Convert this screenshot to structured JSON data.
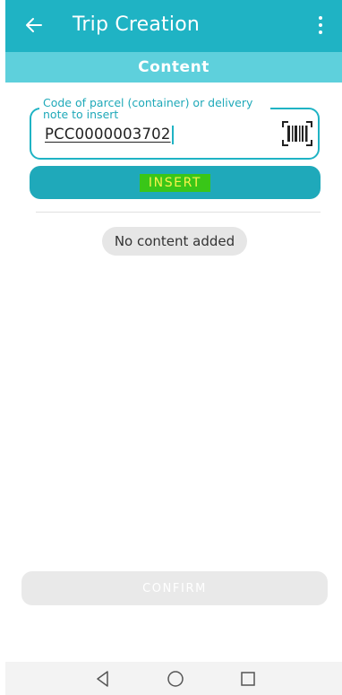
{
  "appbar": {
    "title": "Trip Creation",
    "back_icon": "arrow-left-icon",
    "menu_icon": "more-vertical-icon",
    "color": "#1fb3c4"
  },
  "section": {
    "title": "Content",
    "color": "#5ed0dc"
  },
  "input": {
    "label": "Code of parcel (container) or delivery note to insert",
    "value": "PCC0000003702",
    "scan_icon": "barcode-scan-icon"
  },
  "insert_button": {
    "label": "INSERT",
    "highlight_color": "#39c618"
  },
  "empty_state": {
    "text": "No content added"
  },
  "confirm_button": {
    "label": "CONFIRM",
    "enabled": false
  },
  "navbar": {
    "back_icon": "nav-back-triangle-icon",
    "home_icon": "nav-home-circle-icon",
    "recents_icon": "nav-recents-square-icon"
  }
}
